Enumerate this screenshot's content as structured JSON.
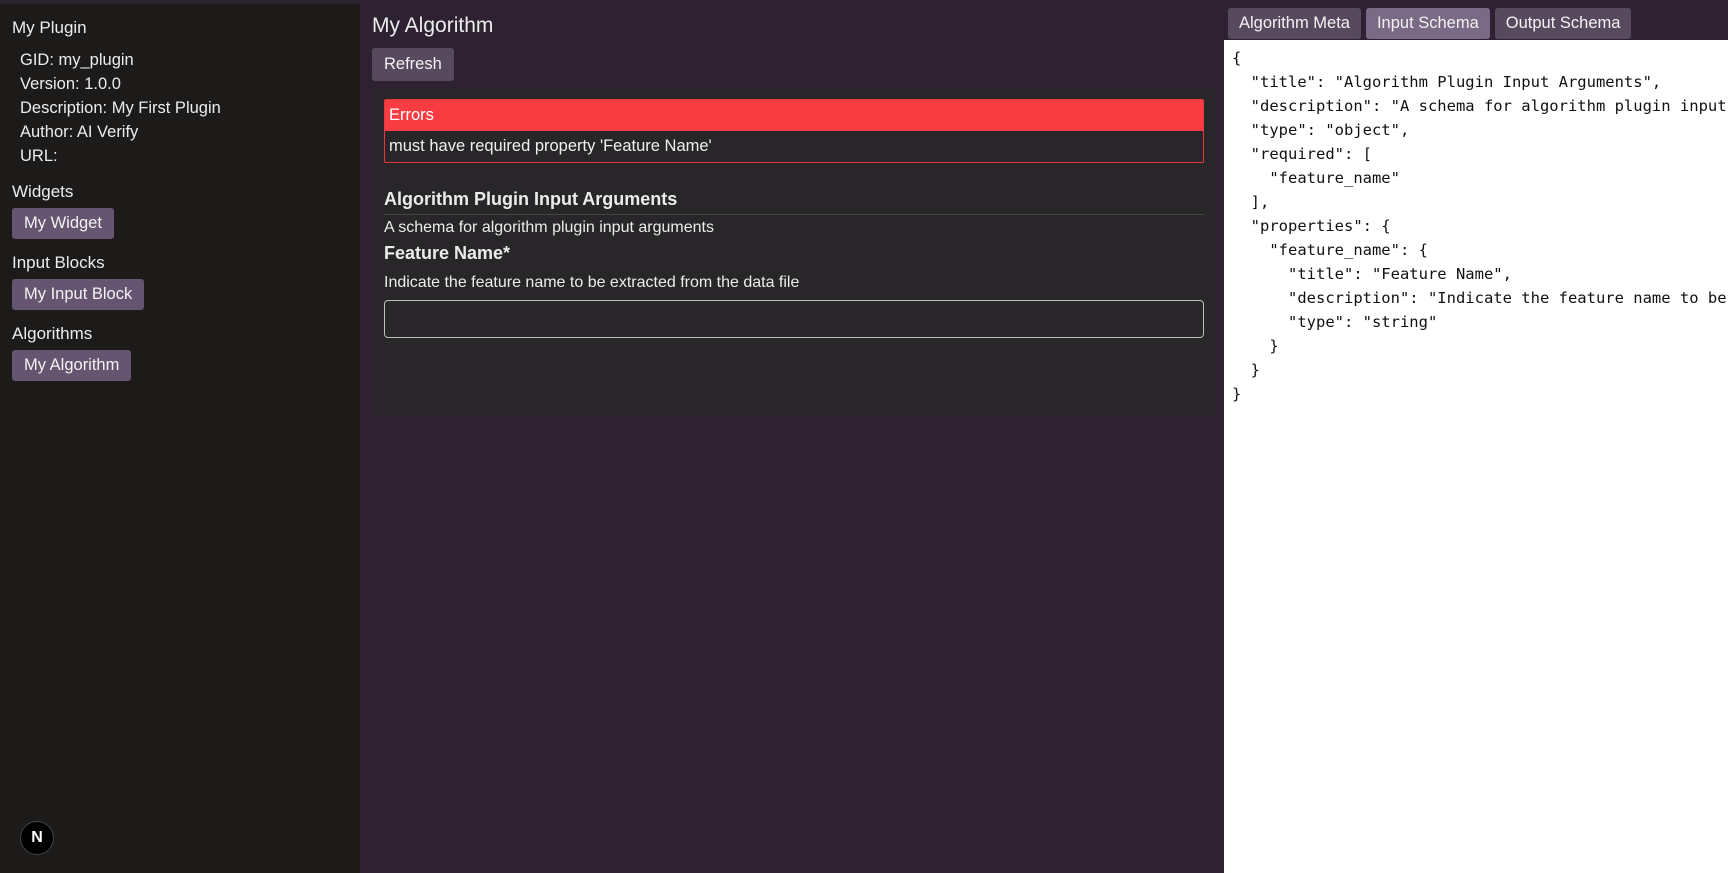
{
  "sidebar": {
    "plugin_name": "My Plugin",
    "meta": {
      "gid": "GID: my_plugin",
      "version": "Version: 1.0.0",
      "description": "Description: My First Plugin",
      "author": "Author: AI Verify",
      "url": "URL:"
    },
    "widgets_title": "Widgets",
    "widget_button": "My Widget",
    "input_blocks_title": "Input Blocks",
    "input_block_button": "My Input Block",
    "algorithms_title": "Algorithms",
    "algorithm_button": "My Algorithm",
    "badge_letter": "N"
  },
  "main": {
    "title": "My Algorithm",
    "refresh_label": "Refresh",
    "errors_title": "Errors",
    "error_message": "must have required property 'Feature Name'",
    "form_title": "Algorithm Plugin Input Arguments",
    "form_description": "A schema for algorithm plugin input arguments",
    "field_label": "Feature Name*",
    "field_help": "Indicate the feature name to be extracted from the data file",
    "field_value": ""
  },
  "right": {
    "tabs": [
      "Algorithm Meta",
      "Input Schema",
      "Output Schema"
    ],
    "active_tab": "Input Schema",
    "code": "{\n  \"title\": \"Algorithm Plugin Input Arguments\",\n  \"description\": \"A schema for algorithm plugin input arguments\",\n  \"type\": \"object\",\n  \"required\": [\n    \"feature_name\"\n  ],\n  \"properties\": {\n    \"feature_name\": {\n      \"title\": \"Feature Name\",\n      \"description\": \"Indicate the feature name to be extracted from the data file\",\n      \"type\": \"string\"\n    }\n  }\n}"
  }
}
